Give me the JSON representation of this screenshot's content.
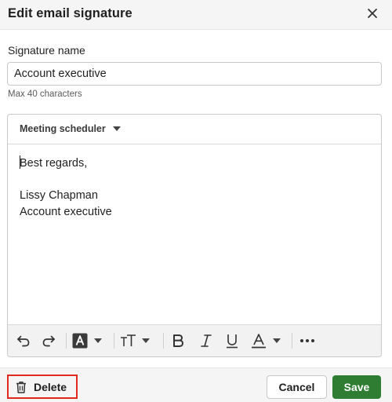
{
  "dialog": {
    "title": "Edit email signature"
  },
  "form": {
    "name_label": "Signature name",
    "name_value": "Account executive",
    "name_hint": "Max 40 characters"
  },
  "editor": {
    "merge_menu_label": "Meeting scheduler",
    "body_lines": [
      "Best regards,",
      "",
      "Lissy Chapman",
      "Account executive"
    ],
    "toolbar_items": [
      "undo-icon",
      "redo-icon",
      "highlight-icon",
      "chevron-down-icon",
      "text-size-icon",
      "chevron-down-icon",
      "bold-icon",
      "italic-icon",
      "underline-icon",
      "text-color-icon",
      "chevron-down-icon",
      "more-icon"
    ]
  },
  "footer": {
    "delete_label": "Delete",
    "cancel_label": "Cancel",
    "save_label": "Save"
  },
  "colors": {
    "primary": "#2e7d32",
    "highlight_box": "#e0281d",
    "header_bg": "#f5f5f5"
  }
}
